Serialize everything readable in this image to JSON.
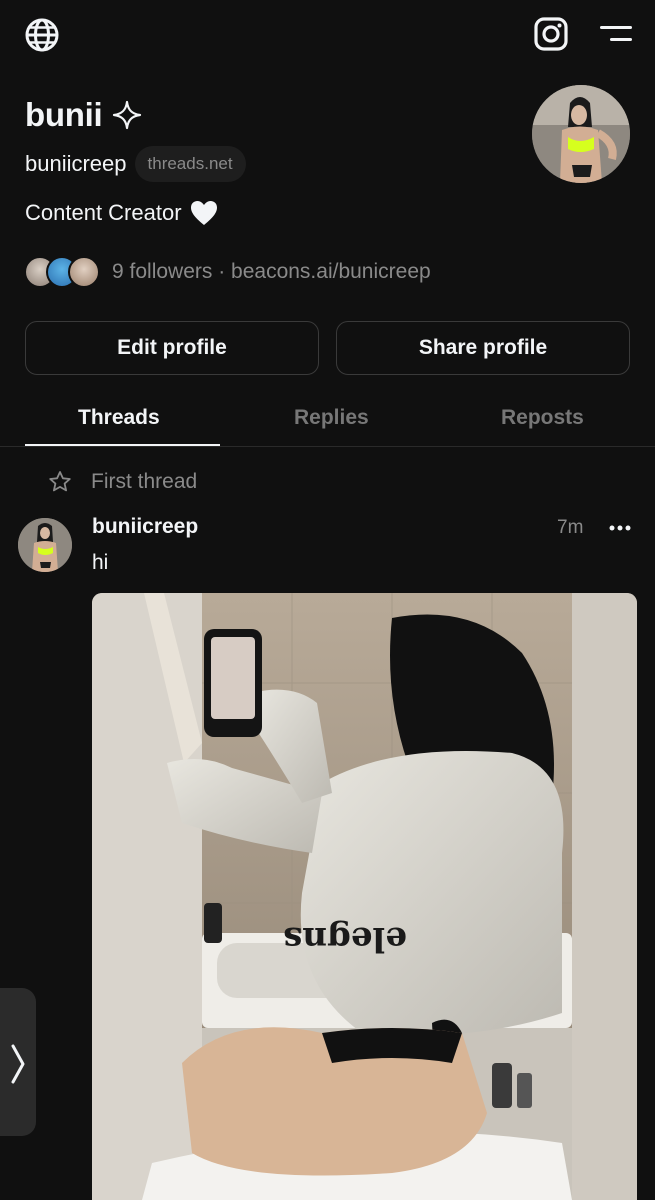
{
  "profile": {
    "name": "bunii",
    "handle": "buniicreep",
    "domain_pill": "threads.net",
    "bio": "Content Creator",
    "followers_text": "9 followers · beacons.ai/bunicreep"
  },
  "buttons": {
    "edit": "Edit profile",
    "share": "Share profile"
  },
  "tabs": [
    {
      "label": "Threads",
      "active": true
    },
    {
      "label": "Replies",
      "active": false
    },
    {
      "label": "Reposts",
      "active": false
    }
  ],
  "pinned": {
    "label": "First thread"
  },
  "post": {
    "username": "buniicreep",
    "time": "7m",
    "body": "hi"
  },
  "icons": [
    "globe-icon",
    "instagram-icon",
    "menu-icon",
    "sparkle-icon",
    "heart-icon",
    "star-icon",
    "more-icon",
    "chevron-right-icon"
  ],
  "colors": {
    "background": "#101010",
    "text": "#f3f5f7",
    "muted": "#8a8a8a",
    "border": "#3a3a3a"
  }
}
